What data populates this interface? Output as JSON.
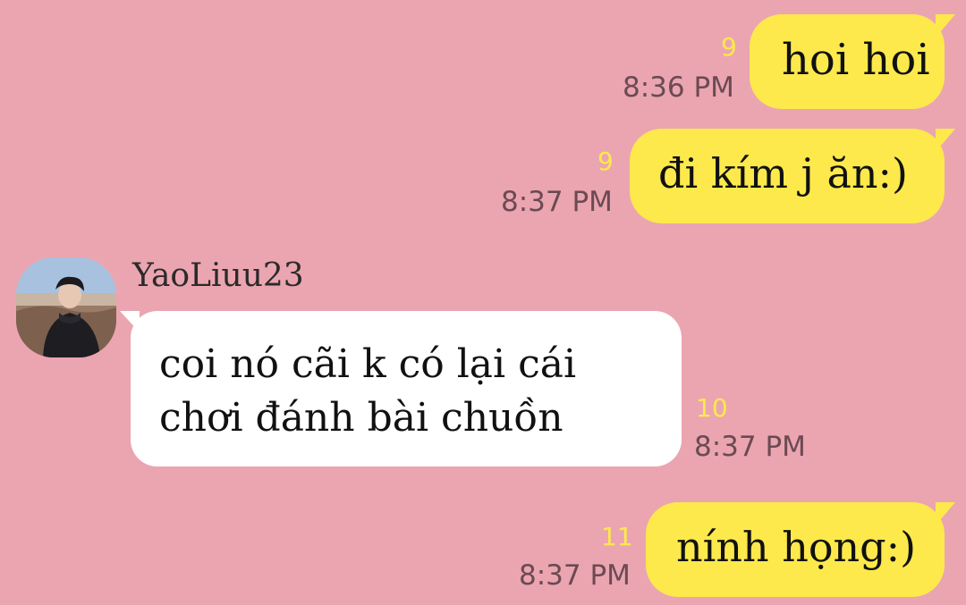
{
  "messages": [
    {
      "direction": "out",
      "text": "hoi hoi",
      "count": "9",
      "time": "8:36 PM"
    },
    {
      "direction": "out",
      "text": "đi kím j ăn:)",
      "count": "9",
      "time": "8:37 PM"
    },
    {
      "direction": "in",
      "sender": "YaoLiuu23",
      "avatar_icon": "profile-photo",
      "lines": [
        "coi nó cãi k có lại cái",
        "chơi đánh bài chuồn"
      ],
      "count": "10",
      "time": "8:37 PM"
    },
    {
      "direction": "out",
      "text": "nính họng:)",
      "count": "11",
      "time": "8:37 PM"
    }
  ],
  "colors": {
    "background": "#eba5b0",
    "outgoing_bubble": "#fde94b",
    "incoming_bubble": "#ffffff",
    "unread_count": "#fde94b",
    "timestamp": "#6b4a53"
  }
}
